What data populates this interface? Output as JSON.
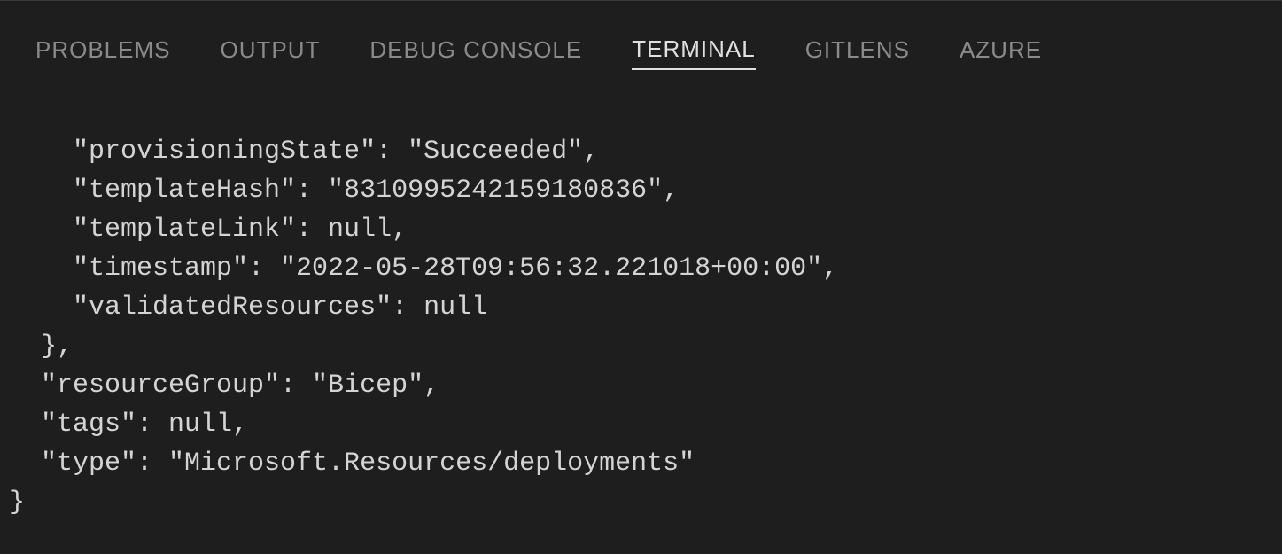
{
  "tabs": {
    "problems": "PROBLEMS",
    "output": "OUTPUT",
    "debug": "DEBUG CONSOLE",
    "terminal": "TERMINAL",
    "gitlens": "GITLENS",
    "azure": "AZURE"
  },
  "terminal": {
    "lines": [
      "    \"provisioningState\": \"Succeeded\",",
      "    \"templateHash\": \"8310995242159180836\",",
      "    \"templateLink\": null,",
      "    \"timestamp\": \"2022-05-28T09:56:32.221018+00:00\",",
      "    \"validatedResources\": null",
      "  },",
      "  \"resourceGroup\": \"Bicep\",",
      "  \"tags\": null,",
      "  \"type\": \"Microsoft.Resources/deployments\"",
      "}"
    ]
  }
}
